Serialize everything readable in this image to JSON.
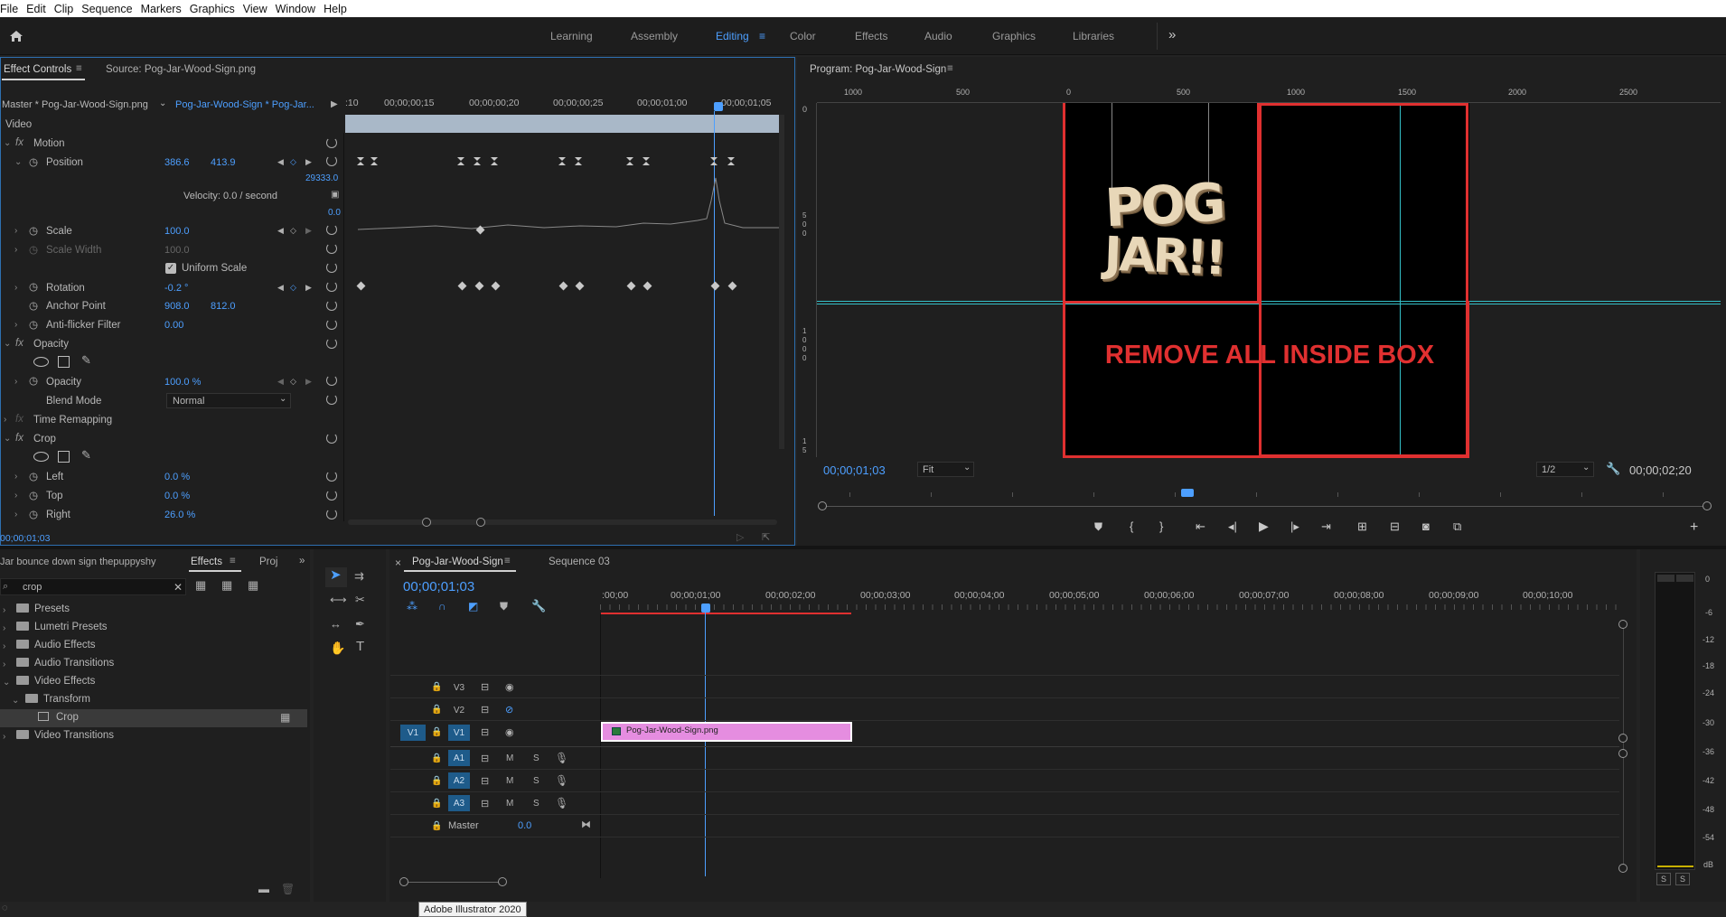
{
  "menu": [
    "File",
    "Edit",
    "Clip",
    "Sequence",
    "Markers",
    "Graphics",
    "View",
    "Window",
    "Help"
  ],
  "workspaces": [
    {
      "label": "Learning",
      "active": false
    },
    {
      "label": "Assembly",
      "active": false
    },
    {
      "label": "Editing",
      "active": true
    },
    {
      "label": "Color",
      "active": false
    },
    {
      "label": "Effects",
      "active": false
    },
    {
      "label": "Audio",
      "active": false
    },
    {
      "label": "Graphics",
      "active": false
    },
    {
      "label": "Libraries",
      "active": false
    }
  ],
  "effect_controls": {
    "tab_label": "Effect Controls",
    "source_tab": "Source: Pog-Jar-Wood-Sign.png",
    "master_label": "Master * Pog-Jar-Wood-Sign.png",
    "clip_label": "Pog-Jar-Wood-Sign * Pog-Jar...",
    "ruler": [
      ":10",
      "00;00;00;15",
      "00;00;00;20",
      "00;00;00;25",
      "00;00;01;00",
      "00;00;01;05"
    ],
    "video_label": "Video",
    "motion": "Motion",
    "position": {
      "label": "Position",
      "x": "386.6",
      "y": "413.9",
      "graph_max": "29333.0",
      "graph_min": "0.0",
      "velocity": "Velocity: 0.0 / second"
    },
    "scale": {
      "label": "Scale",
      "value": "100.0"
    },
    "scale_width": {
      "label": "Scale Width",
      "value": "100.0"
    },
    "uniform_scale": "Uniform Scale",
    "rotation": {
      "label": "Rotation",
      "value": "-0.2 °"
    },
    "anchor": {
      "label": "Anchor Point",
      "x": "908.0",
      "y": "812.0"
    },
    "antiflicker": {
      "label": "Anti-flicker Filter",
      "value": "0.00"
    },
    "opacity_group": "Opacity",
    "opacity": {
      "label": "Opacity",
      "value": "100.0 %"
    },
    "blend": {
      "label": "Blend Mode",
      "value": "Normal"
    },
    "time_remap": "Time Remapping",
    "crop_group": "Crop",
    "left": {
      "label": "Left",
      "value": "0.0 %"
    },
    "top": {
      "label": "Top",
      "value": "0.0 %"
    },
    "right": {
      "label": "Right",
      "value": "26.0 %"
    },
    "timecode": "00;00;01;03"
  },
  "program": {
    "title": "Program: Pog-Jar-Wood-Sign",
    "ruler": [
      "1000",
      "500",
      "0",
      "500",
      "1000",
      "1500",
      "2000",
      "2500"
    ],
    "vruler_top": "0",
    "vruler_mid": "5 0 0",
    "vruler_low": "1 0 0 0",
    "vruler_bottom": "1 5",
    "sign_line1": "POG",
    "sign_line2": "JAR!!",
    "annotation": "REMOVE ALL INSIDE BOX",
    "timecode": "00;00;01;03",
    "fit": "Fit",
    "resolution": "1/2",
    "duration": "00;00;02;20"
  },
  "effects_panel": {
    "project_label": "Jar bounce down sign thepuppyshy",
    "tab": "Effects",
    "tab2": "Proj",
    "search_value": "crop",
    "items": [
      "Presets",
      "Lumetri Presets",
      "Audio Effects",
      "Audio Transitions",
      "Video Effects",
      "Transform",
      "Crop",
      "Video Transitions"
    ]
  },
  "timeline": {
    "tab_active": "Pog-Jar-Wood-Sign",
    "tab_other": "Sequence 03",
    "timecode": "00;00;01;03",
    "ruler": [
      ":00;00",
      "00;00;01;00",
      "00;00;02;00",
      "00;00;03;00",
      "00;00;04;00",
      "00;00;05;00",
      "00;00;06;00",
      "00;00;07;00",
      "00;00;08;00",
      "00;00;09;00",
      "00;00;10;00"
    ],
    "video_tracks": [
      "V3",
      "V2",
      "V1"
    ],
    "audio_tracks": [
      "A1",
      "A2",
      "A3"
    ],
    "source_patch": "V1",
    "master_label": "Master",
    "master_value": "0.0",
    "clip_name": "Pog-Jar-Wood-Sign.png"
  },
  "meter": {
    "scale": [
      "0",
      "-6",
      "-12",
      "-18",
      "-24",
      "-30",
      "-36",
      "-42",
      "-48",
      "-54",
      "dB"
    ],
    "solo": [
      "S",
      "S"
    ]
  },
  "tooltip": "Adobe Illustrator 2020",
  "colors": {
    "accent": "#4d9fff",
    "clip": "#e58de0",
    "annotation": "#e03030",
    "guide": "#35c0c8"
  }
}
